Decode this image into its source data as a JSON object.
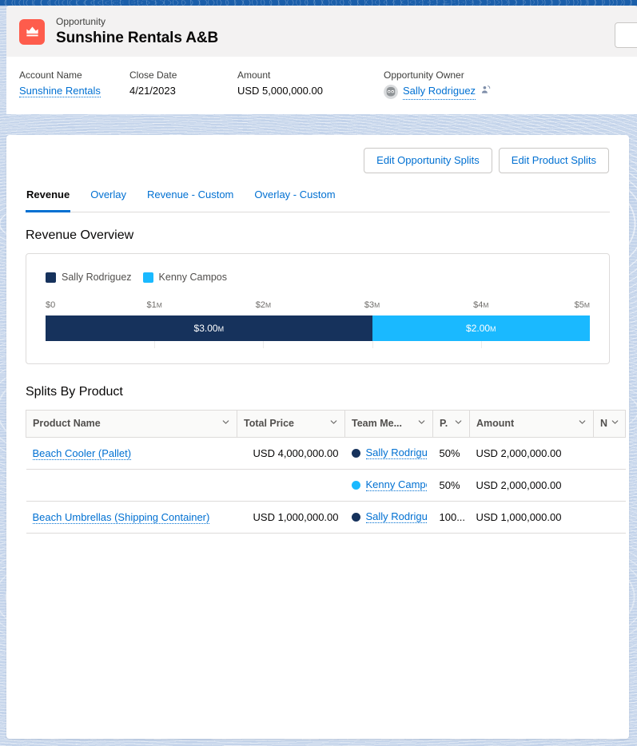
{
  "record": {
    "object_label": "Opportunity",
    "title": "Sunshine Rentals A&B",
    "icon": "opportunity-crown-icon",
    "icon_color": "#fe5c4c"
  },
  "highlights": {
    "fields": [
      {
        "label": "Account Name",
        "value": "Sunshine Rentals",
        "is_link": true
      },
      {
        "label": "Close Date",
        "value": "4/21/2023",
        "is_link": false
      },
      {
        "label": "Amount",
        "value": "USD 5,000,000.00",
        "is_link": false
      }
    ],
    "owner": {
      "label": "Opportunity Owner",
      "name": "Sally Rodriguez",
      "avatar": "user-avatar",
      "change_icon": "change-owner-icon"
    }
  },
  "actions": {
    "edit_opportunity_splits": "Edit Opportunity Splits",
    "edit_product_splits": "Edit Product Splits"
  },
  "tabs": [
    {
      "label": "Revenue",
      "active": true
    },
    {
      "label": "Overlay",
      "active": false
    },
    {
      "label": "Revenue - Custom",
      "active": false
    },
    {
      "label": "Overlay - Custom",
      "active": false
    }
  ],
  "revenue_overview": {
    "heading": "Revenue Overview"
  },
  "chart_data": {
    "type": "bar",
    "orientation": "horizontal",
    "stacked": true,
    "title": "Revenue Overview",
    "xlabel": "",
    "ylabel": "",
    "xlim": [
      0,
      5000000
    ],
    "grid": true,
    "legend_position": "top-left",
    "tick_values": [
      0,
      1000000,
      2000000,
      3000000,
      4000000,
      5000000
    ],
    "tick_labels": [
      "$0",
      "$1M",
      "$2M",
      "$3M",
      "$4M",
      "$5M"
    ],
    "categories": [
      "Revenue"
    ],
    "series": [
      {
        "name": "Sally Rodriguez",
        "values": [
          3000000
        ],
        "data_label": "$3.00M",
        "color": "#16325c"
      },
      {
        "name": "Kenny Campos",
        "values": [
          2000000
        ],
        "data_label": "$2.00M",
        "color": "#1ab9ff"
      }
    ]
  },
  "splits_by_product": {
    "heading": "Splits By Product",
    "columns": [
      {
        "label": "Product Name",
        "align": "left"
      },
      {
        "label": "Total Price",
        "align": "left"
      },
      {
        "label": "Team Me...",
        "align": "left"
      },
      {
        "label": "P.",
        "align": "left"
      },
      {
        "label": "Amount",
        "align": "left"
      },
      {
        "label": "N",
        "align": "left"
      }
    ],
    "rows": [
      {
        "product_name": "Beach Cooler (Pallet)",
        "total_price": "USD 4,000,000.00",
        "team_member": "Sally Rodrigue",
        "member_color": "#16325c",
        "percent": "50%",
        "amount": "USD 2,000,000.00",
        "n": ""
      },
      {
        "product_name": "",
        "total_price": "",
        "team_member": "Kenny Campos",
        "member_color": "#1ab9ff",
        "percent": "50%",
        "amount": "USD 2,000,000.00",
        "n": ""
      },
      {
        "product_name": "Beach Umbrellas (Shipping Container)",
        "total_price": "USD 1,000,000.00",
        "team_member": "Sally Rodrigue",
        "member_color": "#16325c",
        "percent": "100...",
        "amount": "USD 1,000,000.00",
        "n": ""
      }
    ]
  }
}
